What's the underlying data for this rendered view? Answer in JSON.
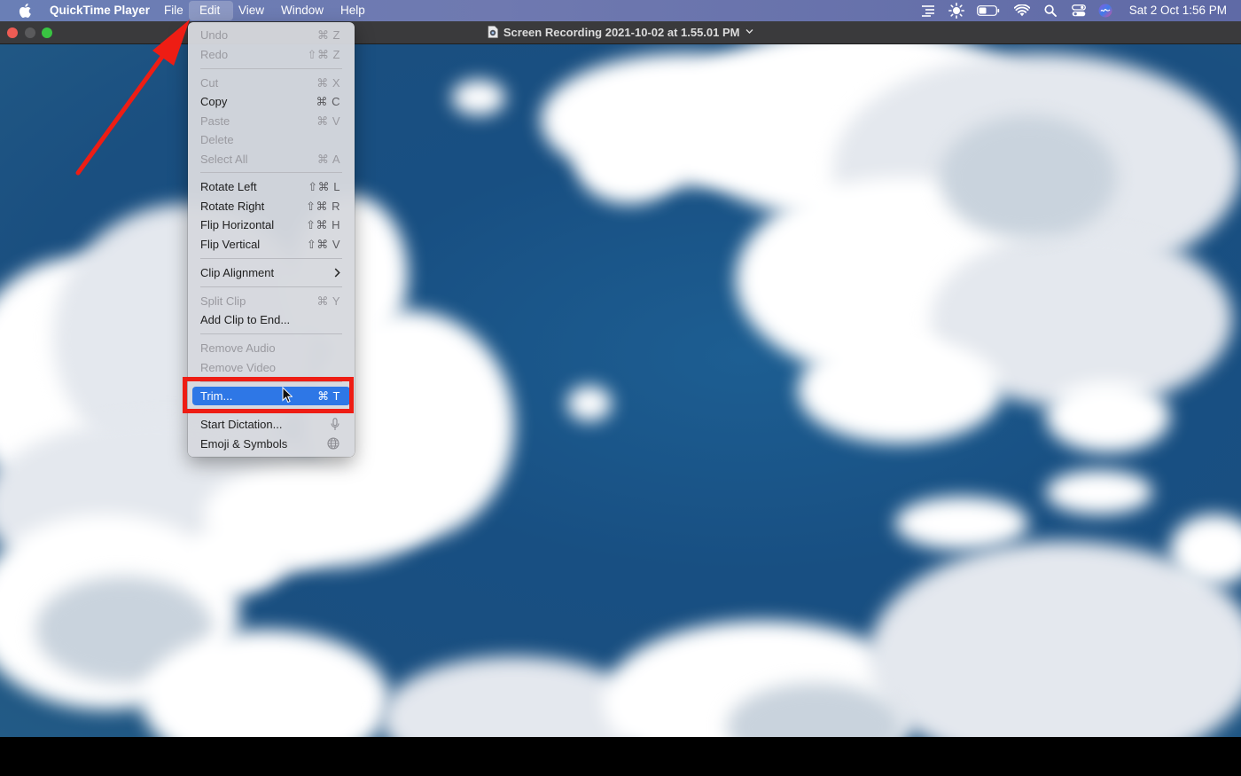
{
  "menubar": {
    "app_name": "QuickTime Player",
    "menus": [
      "File",
      "Edit",
      "View",
      "Window",
      "Help"
    ],
    "active_menu": "Edit",
    "clock": "Sat 2 Oct  1:56 PM"
  },
  "window": {
    "title": "Screen Recording 2021-10-02 at 1.55.01 PM"
  },
  "edit_menu": {
    "items": [
      {
        "label": "Undo",
        "shortcut": "⌘ Z"
      },
      {
        "label": "Redo",
        "shortcut": "⇧⌘ Z"
      },
      {
        "label": "Cut",
        "shortcut": "⌘ X"
      },
      {
        "label": "Copy",
        "shortcut": "⌘ C"
      },
      {
        "label": "Paste",
        "shortcut": "⌘ V"
      },
      {
        "label": "Delete",
        "shortcut": ""
      },
      {
        "label": "Select All",
        "shortcut": "⌘ A"
      },
      {
        "label": "Rotate Left",
        "shortcut": "⇧⌘ L"
      },
      {
        "label": "Rotate Right",
        "shortcut": "⇧⌘ R"
      },
      {
        "label": "Flip Horizontal",
        "shortcut": "⇧⌘ H"
      },
      {
        "label": "Flip Vertical",
        "shortcut": "⇧⌘ V"
      },
      {
        "label": "Clip Alignment",
        "shortcut": ""
      },
      {
        "label": "Split Clip",
        "shortcut": "⌘ Y"
      },
      {
        "label": "Add Clip to End...",
        "shortcut": ""
      },
      {
        "label": "Remove Audio",
        "shortcut": ""
      },
      {
        "label": "Remove Video",
        "shortcut": ""
      },
      {
        "label": "Trim...",
        "shortcut": "⌘ T"
      },
      {
        "label": "Start Dictation...",
        "shortcut": ""
      },
      {
        "label": "Emoji & Symbols",
        "shortcut": ""
      }
    ]
  },
  "colors": {
    "highlight": "#2e77e6",
    "annotation_red": "#ee1d14"
  }
}
